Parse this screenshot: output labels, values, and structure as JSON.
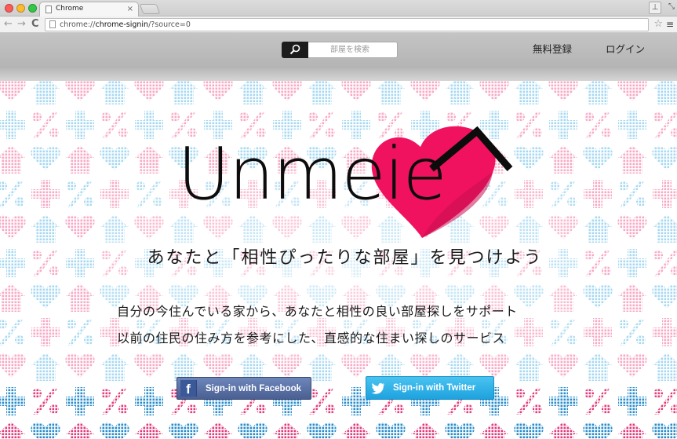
{
  "browser": {
    "tab_title": "Chrome",
    "tab_close": "×",
    "url_prefix": "chrome://",
    "url_host": "chrome-signin",
    "url_path": "/?source=0",
    "back": "←",
    "forward": "→",
    "reload": "C",
    "star": "☆",
    "menu": "≡",
    "user": "⊥",
    "resize": "⤡"
  },
  "header": {
    "search_placeholder": "部屋を検索",
    "register_label": "無料登録",
    "login_label": "ログイン"
  },
  "hero": {
    "logo_text": "Unmeie",
    "tagline": "あなたと「相性ぴったりな部屋」を見つけよう",
    "description_line1": "自分の今住んでいる家から、あなたと相性の良い部屋探しをサポート",
    "description_line2": "以前の住民の住み方を参考にした、直感的な住まい探しのサービス",
    "facebook_icon_letter": "f",
    "facebook_button": "Sign-in with Facebook",
    "twitter_button": "Sign-in with Twitter"
  },
  "colors": {
    "accent_pink": "#f0125e",
    "pattern_pink": "#f6a8c4",
    "pattern_blue": "#a9d9f1",
    "facebook_blue": "#4a5f92",
    "twitter_blue": "#2bb2e8",
    "header_gray": "#bcbcbc"
  },
  "icons": {
    "search": "magnifier-icon",
    "facebook": "facebook-f-icon",
    "twitter": "twitter-bird-icon",
    "logo_heart": "heart-roof-icon"
  }
}
